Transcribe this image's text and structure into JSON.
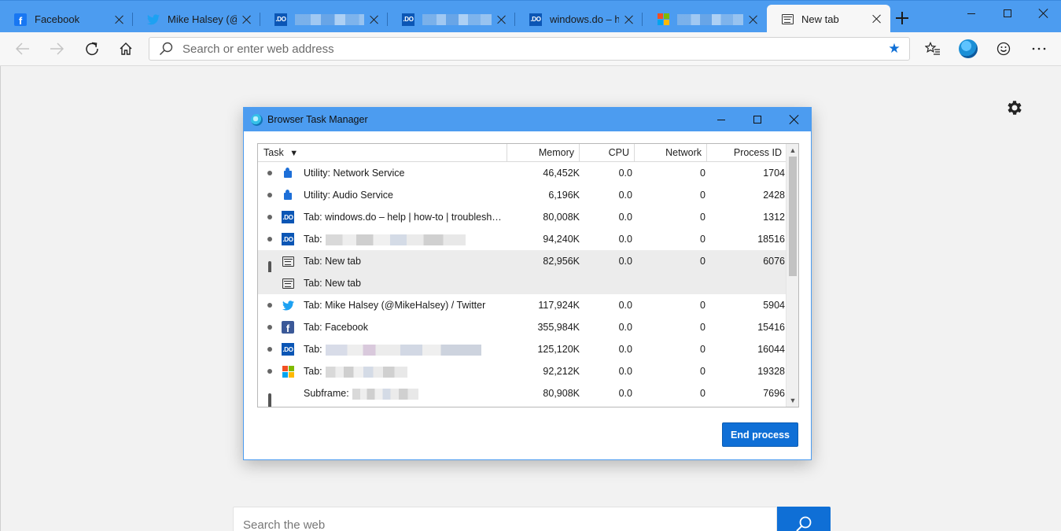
{
  "colors": {
    "accent": "#4c9cf0",
    "button_blue": "#0f6fd6",
    "facebook": "#1877f2",
    "twitter": "#1da1f2",
    "windowsdo": "#0b56b5"
  },
  "tabs": [
    {
      "title": "Facebook",
      "icon": "facebook-icon"
    },
    {
      "title": "Mike Halsey (@Mi",
      "icon": "twitter-icon"
    },
    {
      "title": "",
      "icon": "windowsdo-icon"
    },
    {
      "title": "",
      "icon": "windowsdo-icon"
    },
    {
      "title": "windows.do – help",
      "icon": "windowsdo-icon"
    },
    {
      "title": "",
      "icon": "microsoft-icon"
    },
    {
      "title": "New tab",
      "icon": "new-tab-icon"
    }
  ],
  "addressbar": {
    "placeholder": "Search or enter web address"
  },
  "websearch": {
    "placeholder": "Search the web"
  },
  "taskmanager": {
    "title": "Browser Task Manager",
    "columns": {
      "task": "Task",
      "sort_indicator": "▼",
      "memory": "Memory",
      "cpu": "CPU",
      "network": "Network",
      "pid": "Process ID"
    },
    "rows": [
      {
        "name": "Utility: Network Service",
        "memory": "46,452K",
        "cpu": "0.0",
        "network": "0",
        "pid": "1704",
        "icon": "puzzle-icon"
      },
      {
        "name": "Utility: Audio Service",
        "memory": "6,196K",
        "cpu": "0.0",
        "network": "0",
        "pid": "2428",
        "icon": "puzzle-icon"
      },
      {
        "name": "Tab: windows.do – help | how-to | troubleshooting",
        "memory": "80,008K",
        "cpu": "0.0",
        "network": "0",
        "pid": "1312",
        "icon": "windowsdo-icon"
      },
      {
        "name": "Tab:",
        "memory": "94,240K",
        "cpu": "0.0",
        "network": "0",
        "pid": "18516",
        "icon": "windowsdo-icon"
      },
      {
        "name": "Tab: New tab",
        "memory": "82,956K",
        "cpu": "0.0",
        "network": "0",
        "pid": "6076",
        "icon": "new-tab-icon"
      },
      {
        "name": "Tab: New tab",
        "memory": "",
        "cpu": "",
        "network": "",
        "pid": "",
        "icon": "new-tab-icon"
      },
      {
        "name": "Tab: Mike Halsey (@MikeHalsey) / Twitter",
        "memory": "117,924K",
        "cpu": "0.0",
        "network": "0",
        "pid": "5904",
        "icon": "twitter-icon"
      },
      {
        "name": "Tab: Facebook",
        "memory": "355,984K",
        "cpu": "0.0",
        "network": "0",
        "pid": "15416",
        "icon": "facebook-icon"
      },
      {
        "name": "Tab:",
        "memory": "125,120K",
        "cpu": "0.0",
        "network": "0",
        "pid": "16044",
        "icon": "windowsdo-icon"
      },
      {
        "name": "Tab:",
        "memory": "92,212K",
        "cpu": "0.0",
        "network": "0",
        "pid": "19328",
        "icon": "microsoft-icon"
      },
      {
        "name": "Subframe:",
        "memory": "80,908K",
        "cpu": "0.0",
        "network": "0",
        "pid": "7696",
        "icon": ""
      }
    ],
    "end_process_label": "End process"
  }
}
